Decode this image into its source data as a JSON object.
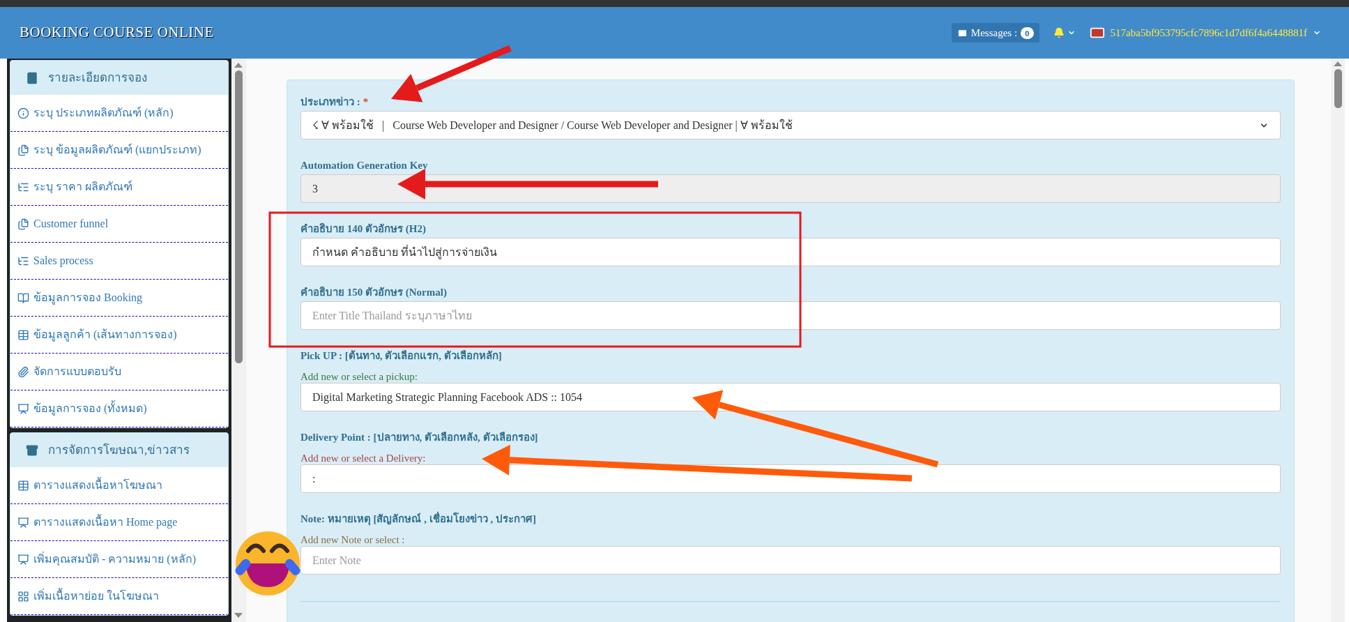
{
  "header": {
    "title": "BOOKING COURSE ONLINE",
    "messages_label": "Messages :",
    "messages_count": "0",
    "user_id": "517aba5bf953795cfc7896c1d7df6f4a6448881f"
  },
  "sidebar": {
    "sections": [
      {
        "title": "รายละเอียดการจอง",
        "items": [
          {
            "label": "ระบุ ประเภทผลิตภัณฑ์ (หลัก)"
          },
          {
            "label": "ระบุ ข้อมูลผลิตภัณฑ์ (แยกประเภท)"
          },
          {
            "label": "ระบุ ราคา ผลิตภัณฑ์"
          },
          {
            "label": "Customer funnel"
          },
          {
            "label": "Sales process"
          },
          {
            "label": "ข้อมูลการจอง Booking"
          },
          {
            "label": "ข้อมูลลูกค้า (เส้นทางการจอง)"
          },
          {
            "label": "จัดการแบบตอบรับ"
          },
          {
            "label": "ข้อมูลการจอง (ทั้งหมด)"
          }
        ]
      },
      {
        "title": "การจัดการโฆษณา,ข่าวสาร",
        "items": [
          {
            "label": "ตารางแสดงเนื้อหาโฆษณา"
          },
          {
            "label": "ตารางแสดงเนื้อหา Home page"
          },
          {
            "label": "เพิ่มคุณสมบัติ - ความหมาย (หลัก)"
          },
          {
            "label": "เพิ่มเนื้อหาย่อย ในโฆษณา"
          }
        ]
      }
    ]
  },
  "form": {
    "fields": [
      {
        "kind": "select",
        "label": "ประเภทข่าว :",
        "required_mark": "*",
        "value": "☇ ∀ พร้อมใช้   |   Course Web Developer and Designer / Course Web Developer and Designer | ∀ พร้อมใช้"
      },
      {
        "kind": "readonly",
        "label": "Automation Generation Key",
        "value": "3"
      },
      {
        "kind": "text",
        "label": "คำอธิบาย 140 ตัวอักษร (H2)",
        "value": "กำหนด คำอธิบาย ที่นำไปสู่การจ่ายเงิน"
      },
      {
        "kind": "text",
        "label": "คำอธิบาย 150 ตัวอักษร (Normal)",
        "placeholder": "Enter Title Thailand ระบุภาษาไทย"
      },
      {
        "kind": "text",
        "label": "Pick UP : [ต้นทาง, ตัวเลือกแรก, ตัวเลือกหลัก]",
        "hint": {
          "text": "Add new or select a pickup:",
          "color": "#3c763d"
        },
        "value": "Digital Marketing Strategic Planning Facebook ADS :: 1054"
      },
      {
        "kind": "text",
        "label": "Delivery Point : [ปลายทาง, ตัวเลือกหลัง, ตัวเลือกรอง]",
        "hint": {
          "text": "Add new or select a Delivery:",
          "color": "#a94442"
        },
        "value": ":"
      },
      {
        "kind": "text",
        "label": "Note: หมายเหตุ [สัญลักษณ์ , เชื่อมโยงข่าว , ประกาศ]",
        "hint": {
          "text": "Add new Note or select :",
          "color": "#8a6d3b"
        },
        "placeholder": "Enter Note"
      }
    ]
  }
}
